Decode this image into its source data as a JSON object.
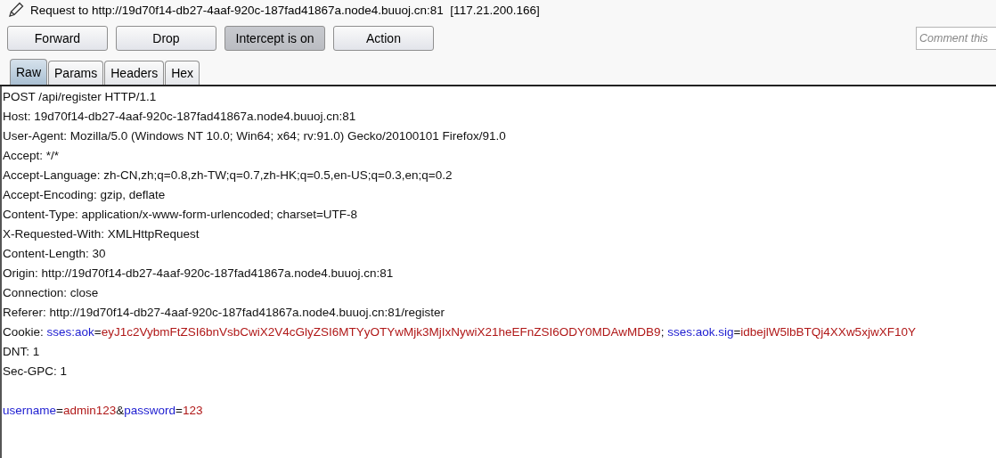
{
  "title": "Request to http://19d70f14-db27-4aaf-920c-187fad41867a.node4.buuoj.cn:81  [117.21.200.166]",
  "buttons": [
    {
      "label": "Forward",
      "pressed": false
    },
    {
      "label": "Drop",
      "pressed": false
    },
    {
      "label": "Intercept is on",
      "pressed": true
    },
    {
      "label": "Action",
      "pressed": false
    }
  ],
  "comment": {
    "placeholder": "Comment this"
  },
  "tabs": [
    {
      "label": "Raw",
      "selected": true
    },
    {
      "label": "Params",
      "selected": false
    },
    {
      "label": "Headers",
      "selected": false
    },
    {
      "label": "Hex",
      "selected": false
    }
  ],
  "raw_lines": [
    [
      {
        "kind": "plain",
        "text": "POST /api/register HTTP/1.1"
      }
    ],
    [
      {
        "kind": "plain",
        "text": "Host: 19d70f14-db27-4aaf-920c-187fad41867a.node4.buuoj.cn:81"
      }
    ],
    [
      {
        "kind": "plain",
        "text": "User-Agent: Mozilla/5.0 (Windows NT 10.0; Win64; x64; rv:91.0) Gecko/20100101 Firefox/91.0"
      }
    ],
    [
      {
        "kind": "plain",
        "text": "Accept: */*"
      }
    ],
    [
      {
        "kind": "plain",
        "text": "Accept-Language: zh-CN,zh;q=0.8,zh-TW;q=0.7,zh-HK;q=0.5,en-US;q=0.3,en;q=0.2"
      }
    ],
    [
      {
        "kind": "plain",
        "text": "Accept-Encoding: gzip, deflate"
      }
    ],
    [
      {
        "kind": "plain",
        "text": "Content-Type: application/x-www-form-urlencoded; charset=UTF-8"
      }
    ],
    [
      {
        "kind": "plain",
        "text": "X-Requested-With: XMLHttpRequest"
      }
    ],
    [
      {
        "kind": "plain",
        "text": "Content-Length: 30"
      }
    ],
    [
      {
        "kind": "plain",
        "text": "Origin: http://19d70f14-db27-4aaf-920c-187fad41867a.node4.buuoj.cn:81"
      }
    ],
    [
      {
        "kind": "plain",
        "text": "Connection: close"
      }
    ],
    [
      {
        "kind": "plain",
        "text": "Referer: http://19d70f14-db27-4aaf-920c-187fad41867a.node4.buuoj.cn:81/register"
      }
    ],
    [
      {
        "kind": "plain",
        "text": "Cookie: "
      },
      {
        "kind": "name",
        "text": "sses:aok"
      },
      {
        "kind": "plain",
        "text": "="
      },
      {
        "kind": "value",
        "text": "eyJ1c2VybmFtZSI6bnVsbCwiX2V4cGlyZSI6MTYyOTYwMjk3MjIxNywiX21heEFnZSI6ODY0MDAwMDB9"
      },
      {
        "kind": "plain",
        "text": "; "
      },
      {
        "kind": "name",
        "text": "sses:aok.sig"
      },
      {
        "kind": "plain",
        "text": "="
      },
      {
        "kind": "value",
        "text": "idbejlW5lbBTQj4XXw5xjwXF10Y"
      }
    ],
    [
      {
        "kind": "plain",
        "text": "DNT: 1"
      }
    ],
    [
      {
        "kind": "plain",
        "text": "Sec-GPC: 1"
      }
    ],
    {
      "kind": "blank"
    },
    [
      {
        "kind": "name",
        "text": "username"
      },
      {
        "kind": "plain",
        "text": "="
      },
      {
        "kind": "value",
        "text": "admin123"
      },
      {
        "kind": "plain",
        "text": "&"
      },
      {
        "kind": "name",
        "text": "password"
      },
      {
        "kind": "plain",
        "text": "="
      },
      {
        "kind": "value",
        "text": "123"
      }
    ]
  ]
}
